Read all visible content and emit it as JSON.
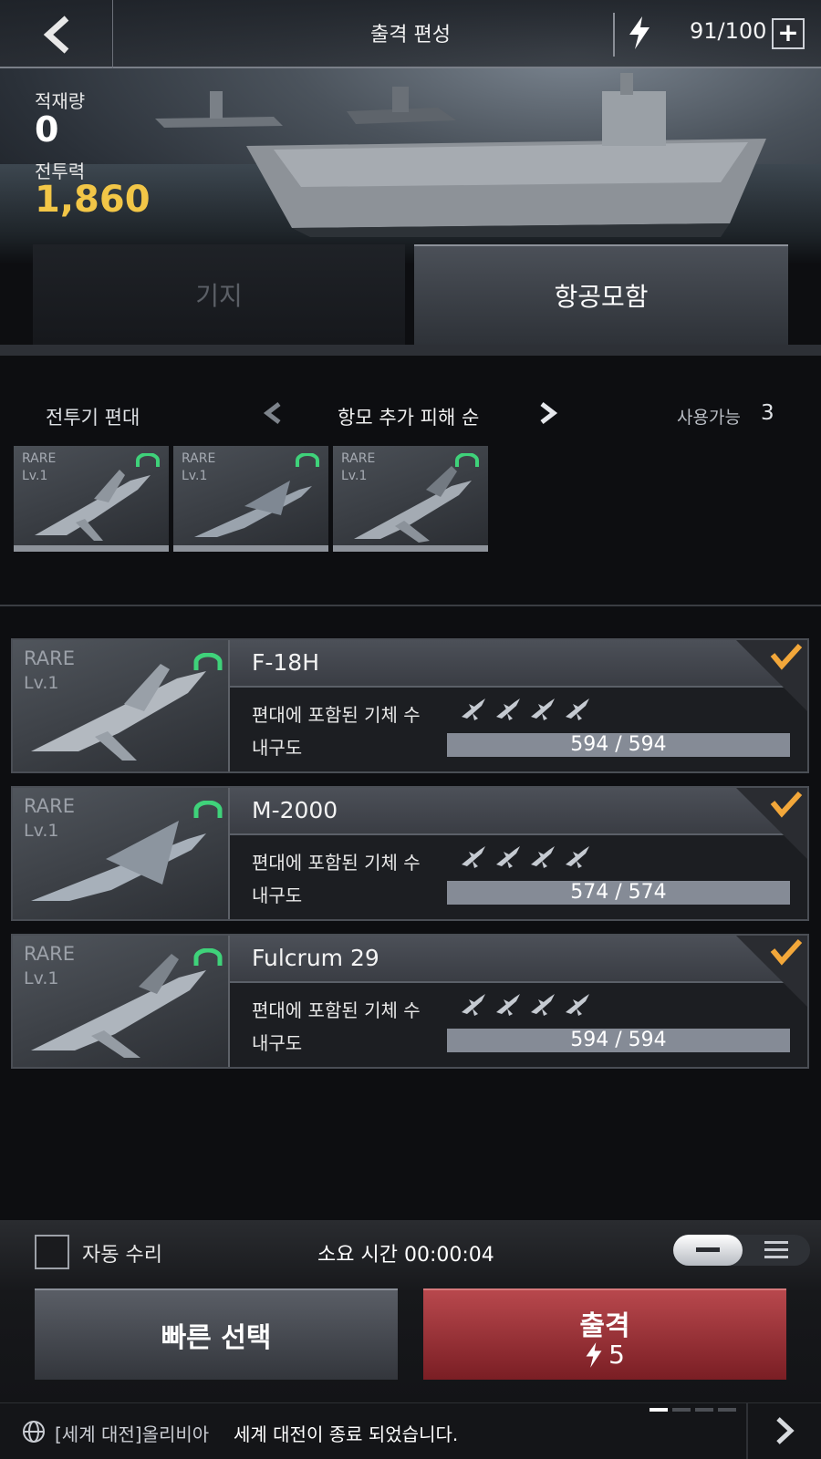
{
  "header": {
    "title": "출격 편성",
    "energy": "91/100",
    "plus": "+"
  },
  "hero": {
    "load_label": "적재량",
    "load_value": "0",
    "power_label": "전투력",
    "power_value": "1,860"
  },
  "tabs": [
    {
      "label": "기지",
      "active": false
    },
    {
      "label": "항공모함",
      "active": true
    }
  ],
  "squad": {
    "title": "전투기 편대",
    "sort_label": "항모 추가 피해 순",
    "available_label": "사용가능",
    "available_count": "3",
    "slots": [
      {
        "rarity": "RARE",
        "level": "Lv.1"
      },
      {
        "rarity": "RARE",
        "level": "Lv.1"
      },
      {
        "rarity": "RARE",
        "level": "Lv.1"
      }
    ]
  },
  "aircraft": [
    {
      "rarity": "RARE",
      "level": "Lv.1",
      "name": "F-18H",
      "count_label": "편대에 포함된 기체 수",
      "durability_label": "내구도",
      "durability_text": "594 / 594",
      "durability_fraction": 1.0,
      "selected": true
    },
    {
      "rarity": "RARE",
      "level": "Lv.1",
      "name": "M-2000",
      "count_label": "편대에 포함된 기체 수",
      "durability_label": "내구도",
      "durability_text": "574 / 574",
      "durability_fraction": 1.0,
      "selected": true
    },
    {
      "rarity": "RARE",
      "level": "Lv.1",
      "name": "Fulcrum 29",
      "count_label": "편대에 포함된 기체 수",
      "durability_label": "내구도",
      "durability_text": "594 / 594",
      "durability_fraction": 1.0,
      "selected": true
    }
  ],
  "aircraft_count_per_squad": 4,
  "controls": {
    "auto_repair_label": "자동 수리",
    "time_label": "소요 시간 00:00:04",
    "quick_select_label": "빠른 선택",
    "sortie_label": "출격",
    "sortie_cost": "5"
  },
  "ticker": {
    "tag": "[세계 대전]올리비아",
    "message": "세계 대전이 종료 되었습니다."
  },
  "colors": {
    "accent_gold": "#f2c647",
    "sortie_red": "#a8363c",
    "badge_green": "#3fd27a",
    "check_orange": "#f2a73a"
  }
}
